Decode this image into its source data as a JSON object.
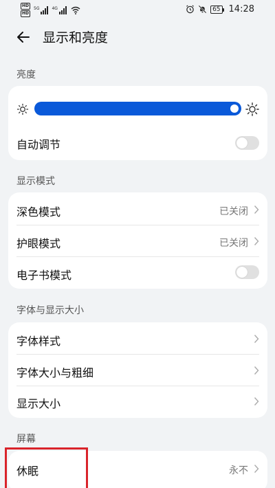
{
  "status_bar": {
    "hd1": "HD",
    "hd2": "HD",
    "signal1_label": "5G",
    "signal2_label": "4G",
    "battery": "65",
    "time": "14:28"
  },
  "header": {
    "title": "显示和亮度"
  },
  "brightness": {
    "section_title": "亮度",
    "level": 1.0,
    "auto_label": "自动调节",
    "auto_on": false
  },
  "display_mode": {
    "section_title": "显示模式",
    "items": [
      {
        "label": "深色模式",
        "value": "已关闭"
      },
      {
        "label": "护眼模式",
        "value": "已关闭"
      },
      {
        "label": "电子书模式"
      }
    ]
  },
  "font_size": {
    "section_title": "字体与显示大小",
    "items": [
      {
        "label": "字体样式"
      },
      {
        "label": "字体大小与粗细"
      },
      {
        "label": "显示大小"
      }
    ]
  },
  "screen": {
    "section_title": "屏幕",
    "items": [
      {
        "label": "休眠",
        "value": "永不"
      }
    ]
  },
  "colors": {
    "accent": "#0a59d9",
    "highlight": "#d9232a"
  },
  "icons": {
    "back": "arrow-left-icon",
    "sun": "sun-icon",
    "chevron": "chevron-right-icon"
  }
}
